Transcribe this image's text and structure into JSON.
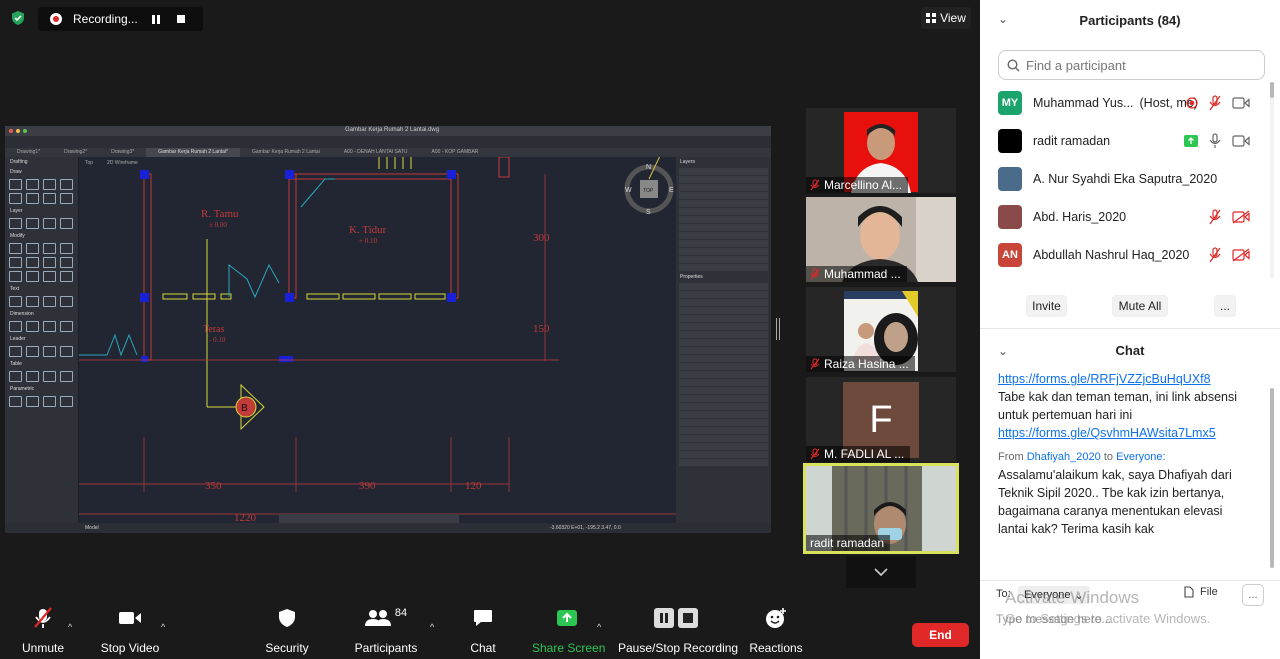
{
  "recording": {
    "label": "Recording..."
  },
  "view_button": {
    "label": "View"
  },
  "cad": {
    "window_title": "Gambar Kerja Rumah 2 Lantai.dwg",
    "tabs": [
      "Drawing1*",
      "Drawing2*",
      "Drawing3*",
      "Gambar Kerja Rumah 2 Lantai*",
      "Gambar Kerja Rumah 2 Lantai",
      "A00 - DENAH LANTAI SATU",
      "A00 - KOP GAMBAR"
    ],
    "left_panel_title": "Drafting",
    "left_sections": [
      "Draw",
      "Layer",
      "Modify",
      "Text",
      "Dimension",
      "Leader",
      "Table",
      "Parametric"
    ],
    "right_panel_title": "Layers",
    "properties_title": "Properties",
    "view_labels": [
      "Top",
      "2D Wireframe"
    ],
    "labels": {
      "room1": "R. Tamu",
      "room1_elev": "± 0.00",
      "room2": "K. Tidur",
      "room2_elev": "+ 0.10",
      "room3": "Teras",
      "room3_elev": "- 0.10",
      "dim_300": "300",
      "dim_150": "150",
      "dim_350": "350",
      "dim_390": "390",
      "dim_120": "120",
      "dim_1220": "1220",
      "marker": "B"
    },
    "compass": {
      "n": "N",
      "s": "S",
      "e": "E",
      "w": "W",
      "top": "TOP"
    },
    "status_left": "Model",
    "status_right": "-3.60320 E+01, -195.2 3.47, 0.0"
  },
  "tiles": [
    {
      "name": "Marcellino Al..."
    },
    {
      "name": "Muhammad ..."
    },
    {
      "name": "Raiza Hasina ..."
    },
    {
      "name": "M. FADLI AL ...",
      "initial": "F"
    },
    {
      "name": "radit ramadan"
    }
  ],
  "toolbar": {
    "unmute": "Unmute",
    "stop_video": "Stop Video",
    "security": "Security",
    "participants": "Participants",
    "participants_count": "84",
    "chat": "Chat",
    "share_screen": "Share Screen",
    "pause_stop": "Pause/Stop Recording",
    "reactions": "Reactions",
    "end": "End"
  },
  "participants_panel": {
    "title": "Participants (84)",
    "search_placeholder": "Find a participant",
    "items": [
      {
        "initials": "MY",
        "name": "Muhammad Yus...",
        "tag": "(Host, me)",
        "color": "#1aa36b"
      },
      {
        "initials": "",
        "name": "radit ramadan",
        "tag": "",
        "color": "#000000"
      },
      {
        "initials": "",
        "name": "A. Nur Syahdi Eka Saputra_2020",
        "tag": "",
        "color": "#4a6b8a"
      },
      {
        "initials": "",
        "name": "Abd. Haris_2020",
        "tag": "",
        "color": "#8a4a4a"
      },
      {
        "initials": "AN",
        "name": "Abdullah Nashrul Haq_2020",
        "tag": "",
        "color": "#c8453a"
      }
    ],
    "invite": "Invite",
    "mute_all": "Mute All",
    "more": "..."
  },
  "chat_panel": {
    "title": "Chat",
    "link1": "https://forms.gle/RRFjVZZjcBuHqUXf8",
    "msg1": "Tabe kak dan teman teman, ini link absensi untuk pertemuan hari ini",
    "link2": "https://forms.gle/QsvhmHAWsita7Lmx5",
    "from_label": "From",
    "from_name": "Dhafiyah_2020",
    "to_label": "to",
    "to_name": "Everyone:",
    "msg2": "Assalamu'alaikum kak, saya Dhafiyah dari Teknik Sipil 2020.. Tbe kak izin bertanya, bagaimana caranya menentukan elevasi lantai kak? Terima kasih kak",
    "to": "To:",
    "recipient": "Everyone",
    "file": "File",
    "more": "...",
    "input_placeholder": "Type message here..."
  },
  "watermark": {
    "line1": "Activate Windows",
    "line2": "Go to Settings to activate Windows."
  }
}
